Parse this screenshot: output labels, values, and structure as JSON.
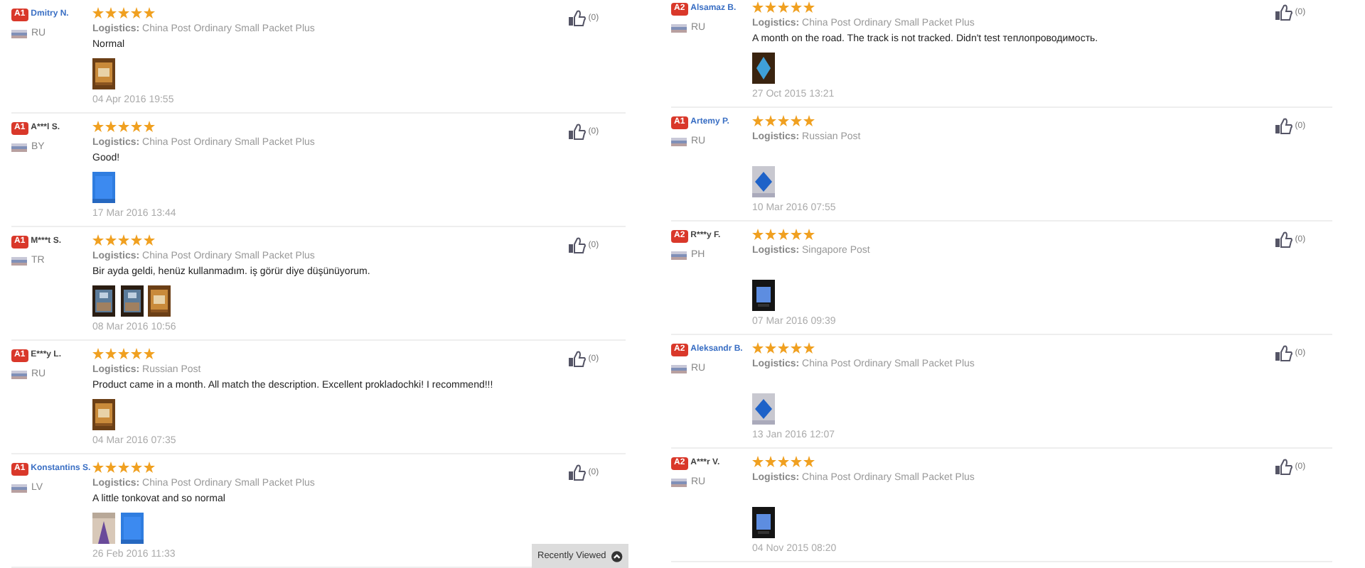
{
  "columns": [
    {
      "reviews": [
        {
          "badge": "A1",
          "name": "Dmitry N.",
          "name_link": true,
          "country": "RU",
          "rating": {
            "stars": 5
          },
          "logistics_label": "Logistics:",
          "logistics": "China Post Ordinary Small Packet Plus",
          "text": "Normal",
          "date": "04 Apr 2016 19:55",
          "likes": "(0)"
        },
        {
          "badge": "A1",
          "name": "A***l S.",
          "name_link": false,
          "country": "BY",
          "rating": {
            "stars": 5
          },
          "logistics_label": "Logistics:",
          "logistics": "China Post Ordinary Small Packet Plus",
          "text": "Good!",
          "date": "17 Mar 2016 13:44",
          "likes": "(0)"
        },
        {
          "badge": "A1",
          "name": "M***t S.",
          "name_link": false,
          "country": "TR",
          "rating": {
            "stars": 5
          },
          "logistics_label": "Logistics:",
          "logistics": "China Post Ordinary Small Packet Plus",
          "text": "Bir ayda geldi, henüz kullanmadım. iş görür diye düşünüyorum.",
          "date": "08 Mar 2016 10:56",
          "likes": "(0)"
        },
        {
          "badge": "A1",
          "name": "E***y L.",
          "name_link": false,
          "country": "RU",
          "rating": {
            "stars": 5
          },
          "logistics_label": "Logistics:",
          "logistics": "Russian Post",
          "text": "Product came in a month. All match the description. Excellent prokladochki! I recommend!!!",
          "date": "04 Mar 2016 07:35",
          "likes": "(0)"
        },
        {
          "badge": "A1",
          "name": "Konstantins S.",
          "name_link": true,
          "country": "LV",
          "rating": {
            "stars": 5
          },
          "logistics_label": "Logistics:",
          "logistics": "China Post Ordinary Small Packet Plus",
          "text": "A little tonkovat and so normal",
          "date": "26 Feb 2016 11:33",
          "likes": "(0)"
        }
      ]
    },
    {
      "reviews": [
        {
          "badge": "A2",
          "name": "Alsamaz B.",
          "name_link": true,
          "country": "RU",
          "rating": {
            "stars": 5
          },
          "logistics_label": "Logistics:",
          "logistics": "China Post Ordinary Small Packet Plus",
          "text": "A month on the road. The track is not tracked. Didn't test теплопроводимость.",
          "date": "27 Oct 2015 13:21",
          "likes": "(0)"
        },
        {
          "badge": "A1",
          "name": "Artemy P.",
          "name_link": true,
          "country": "RU",
          "rating": {
            "stars": 5
          },
          "logistics_label": "Logistics:",
          "logistics": "Russian Post",
          "date": "10 Mar 2016 07:55",
          "likes": "(0)"
        },
        {
          "badge": "A2",
          "name": "R***y F.",
          "name_link": false,
          "country": "PH",
          "rating": {
            "stars": 5
          },
          "logistics_label": "Logistics:",
          "logistics": "Singapore Post",
          "date": "07 Mar 2016 09:39",
          "likes": "(0)"
        },
        {
          "badge": "A2",
          "name": "Aleksandr B.",
          "name_link": true,
          "country": "RU",
          "rating": {
            "stars": 5
          },
          "logistics_label": "Logistics:",
          "logistics": "China Post Ordinary Small Packet Plus",
          "date": "13 Jan 2016 12:07",
          "likes": "(0)"
        },
        {
          "badge": "A2",
          "name": "A***r V.",
          "name_link": false,
          "country": "RU",
          "rating": {
            "stars": 5
          },
          "logistics_label": "Logistics:",
          "logistics": "China Post Ordinary Small Packet Plus",
          "date": "04 Nov 2015 08:20",
          "likes": "(0)"
        }
      ]
    }
  ],
  "recently_viewed": {
    "label": "Recently Viewed"
  }
}
